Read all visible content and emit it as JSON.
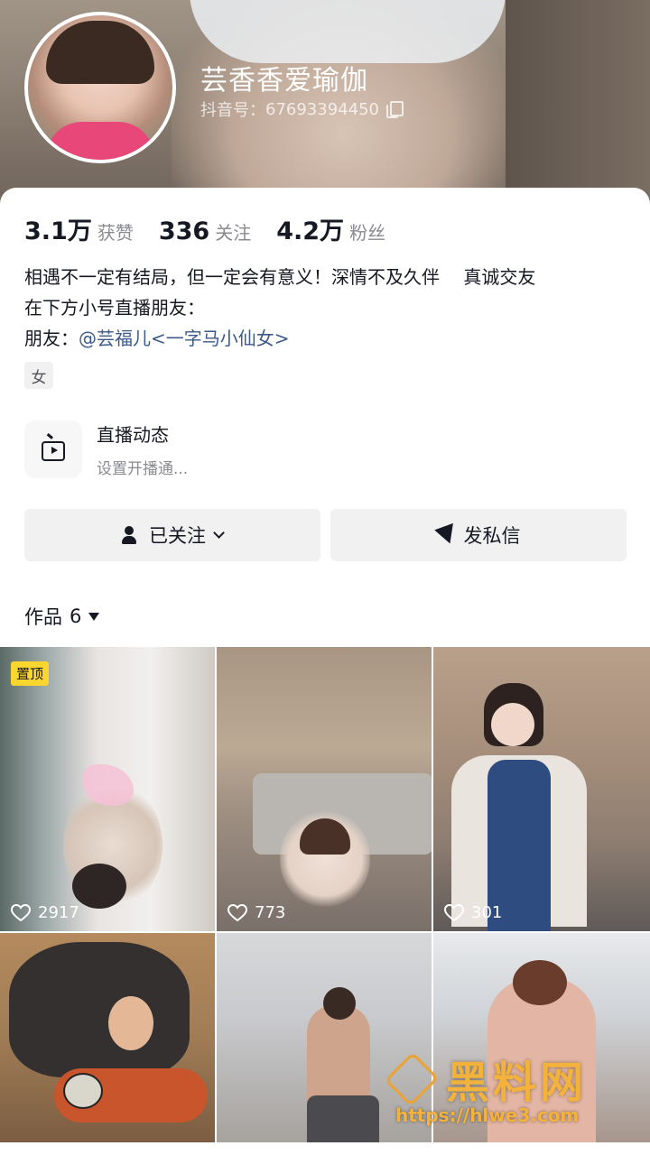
{
  "profile": {
    "nickname": "芸香香爱瑜伽",
    "douyin_id_label": "抖音号：",
    "douyin_id": "67693394450"
  },
  "stats": [
    {
      "value": "3.1万",
      "label": "获赞"
    },
    {
      "value": "336",
      "label": "关注"
    },
    {
      "value": "4.2万",
      "label": "粉丝"
    }
  ],
  "bio": {
    "line1": "相遇不一定有结局，但一定会有意义！深情不及久伴　 真诚交友",
    "line2": "在下方小号直播朋友：",
    "line3_prefix": "朋友：",
    "line3_link": "@芸福儿<一字马小仙女>"
  },
  "gender_tag": "女",
  "live_entry": {
    "title": "直播动态",
    "subtitle": "设置开播通..."
  },
  "buttons": {
    "follow_label": "已关注",
    "message_label": "发私信"
  },
  "works_tab": {
    "label": "作品",
    "count": "6"
  },
  "videos": [
    {
      "likes": "2917",
      "pinned_label": "置顶"
    },
    {
      "likes": "773"
    },
    {
      "likes": "301"
    },
    {
      "likes": ""
    },
    {
      "likes": ""
    },
    {
      "likes": ""
    }
  ],
  "watermark": {
    "title": "黑料网",
    "url": "https://hlwe3.com"
  }
}
